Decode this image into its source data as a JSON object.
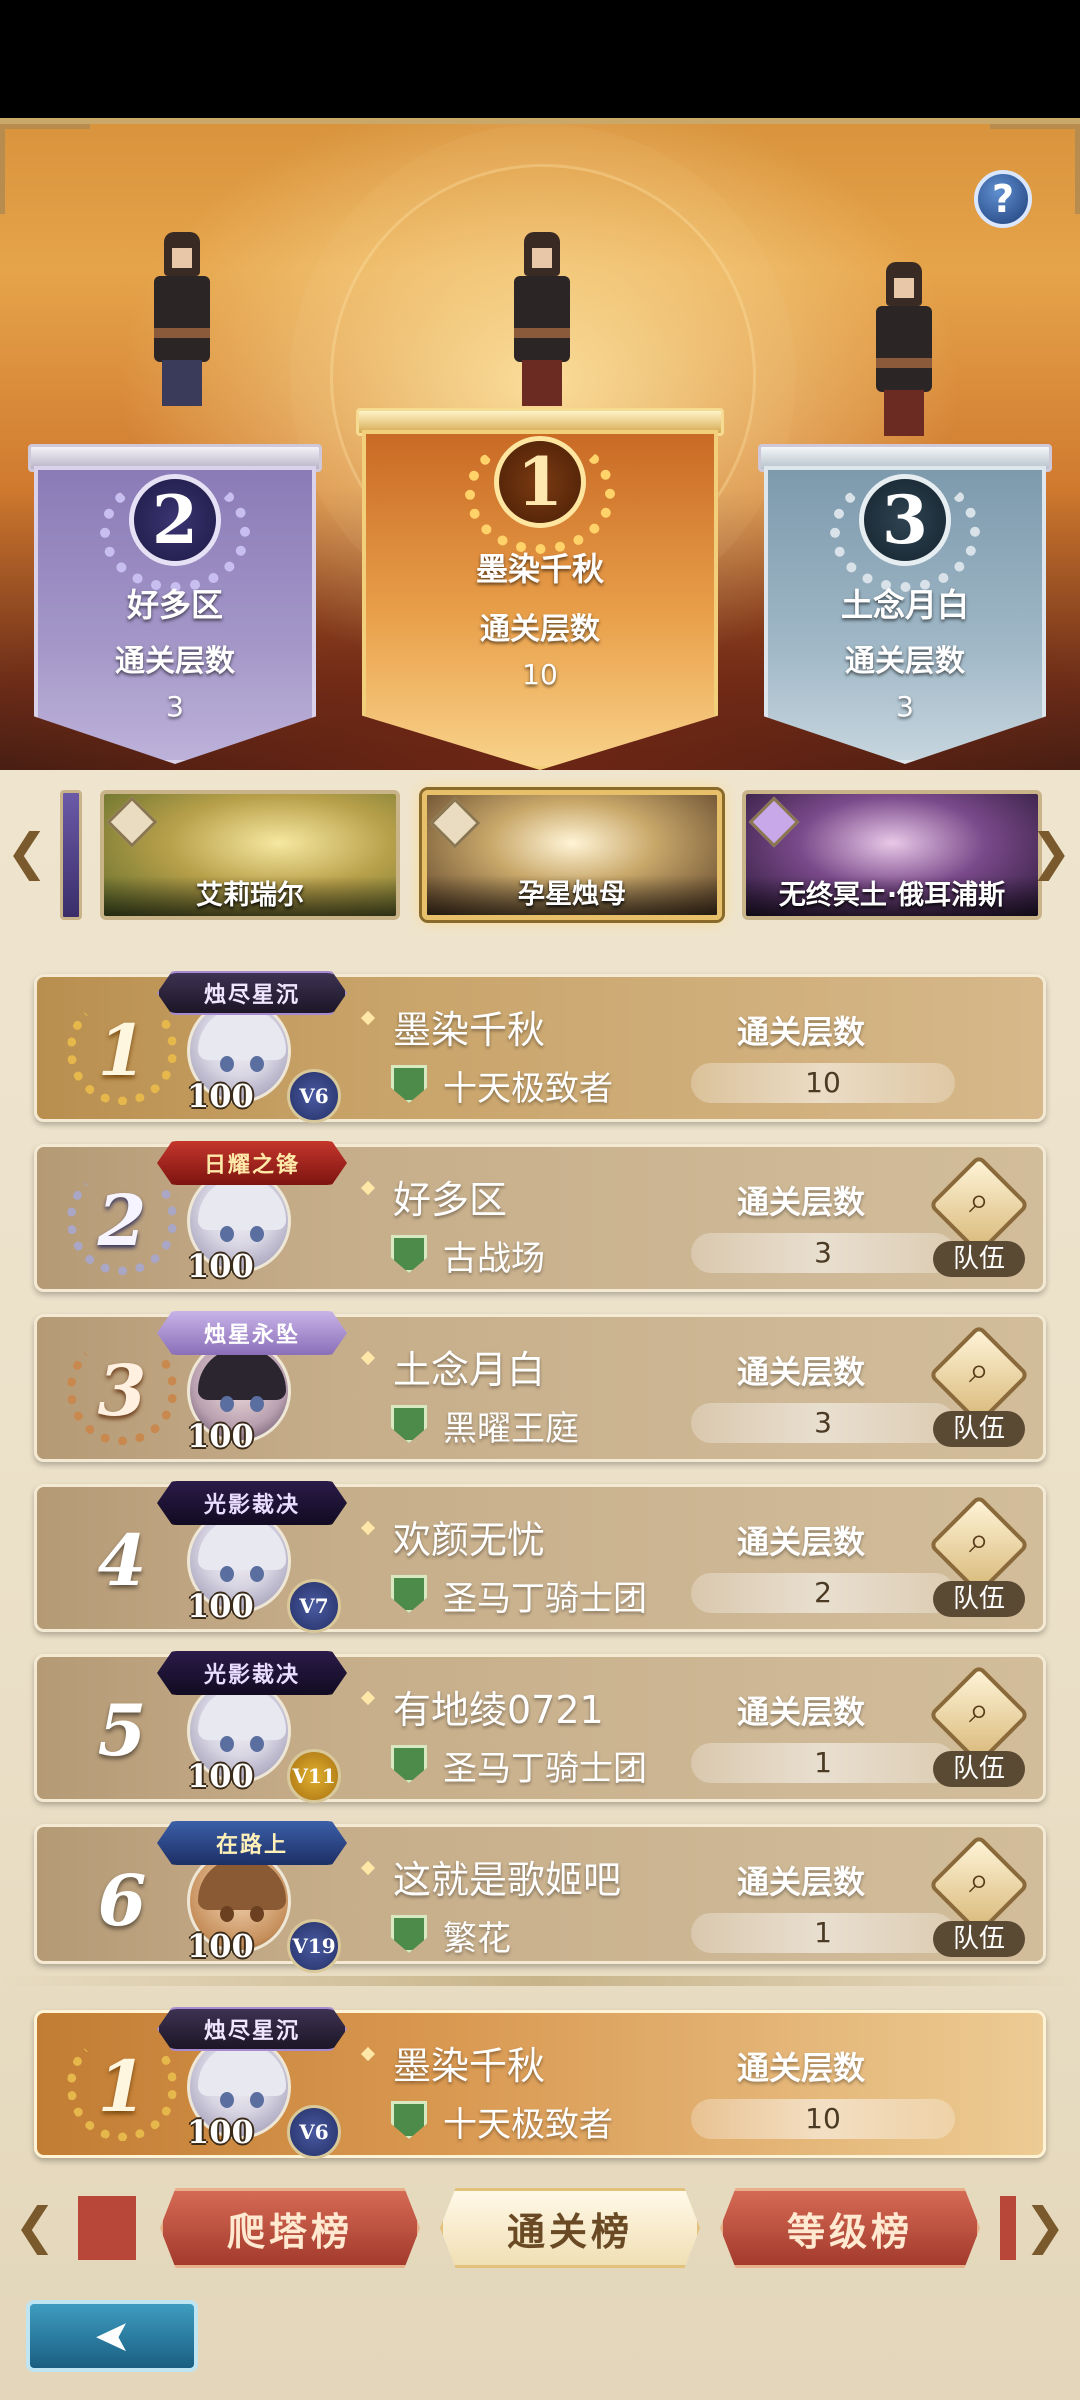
{
  "help_icon": "question-icon",
  "podium": [
    {
      "rank": "2",
      "name": "好多区",
      "label": "通关层数",
      "value": "3"
    },
    {
      "rank": "1",
      "name": "墨染千秋",
      "label": "通关层数",
      "value": "10"
    },
    {
      "rank": "3",
      "name": "土念月白",
      "label": "通关层数",
      "value": "3"
    }
  ],
  "bosses": [
    {
      "name": "艾莉瑞尔",
      "selected": false
    },
    {
      "name": "孕星烛母",
      "selected": true
    },
    {
      "name": "无终冥土·俄耳浦斯",
      "selected": false
    }
  ],
  "ranking": [
    {
      "rank": "1",
      "title": "烛尽星沉",
      "level": "100",
      "vip": "V6",
      "name": "墨染千秋",
      "guild": "十天极致者",
      "score_label": "通关层数",
      "score": "10"
    },
    {
      "rank": "2",
      "title": "日耀之锋",
      "level": "100",
      "vip": "",
      "name": "好多区",
      "guild": "古战场",
      "score_label": "通关层数",
      "score": "3",
      "team_label": "队伍"
    },
    {
      "rank": "3",
      "title": "烛星永坠",
      "level": "100",
      "vip": "",
      "name": "土念月白",
      "guild": "黑曜王庭",
      "score_label": "通关层数",
      "score": "3",
      "team_label": "队伍"
    },
    {
      "rank": "4",
      "title": "光影裁决",
      "level": "100",
      "vip": "V7",
      "name": "欢颜无忧",
      "guild": "圣马丁骑士团",
      "score_label": "通关层数",
      "score": "2",
      "team_label": "队伍"
    },
    {
      "rank": "5",
      "title": "光影裁决",
      "level": "100",
      "vip": "V11",
      "name": "有地绫0721",
      "guild": "圣马丁骑士团",
      "score_label": "通关层数",
      "score": "1",
      "team_label": "队伍"
    },
    {
      "rank": "6",
      "title": "在路上",
      "level": "100",
      "vip": "V19",
      "name": "这就是歌姬吧",
      "guild": "繁花",
      "score_label": "通关层数",
      "score": "1",
      "team_label": "队伍"
    }
  ],
  "my_rank": {
    "rank": "1",
    "title": "烛尽星沉",
    "level": "100",
    "vip": "V6",
    "name": "墨染千秋",
    "guild": "十天极致者",
    "score_label": "通关层数",
    "score": "10"
  },
  "tabs": [
    {
      "label": "爬塔榜",
      "active": false
    },
    {
      "label": "通关榜",
      "active": true
    },
    {
      "label": "等级榜",
      "active": false
    }
  ],
  "back_icon": "back-arrow-icon",
  "colors": {
    "accent_gold": "#e6b84c",
    "panel": "#efe5cf",
    "tab_red": "#a33a2c",
    "back_blue": "#1a5f82"
  }
}
